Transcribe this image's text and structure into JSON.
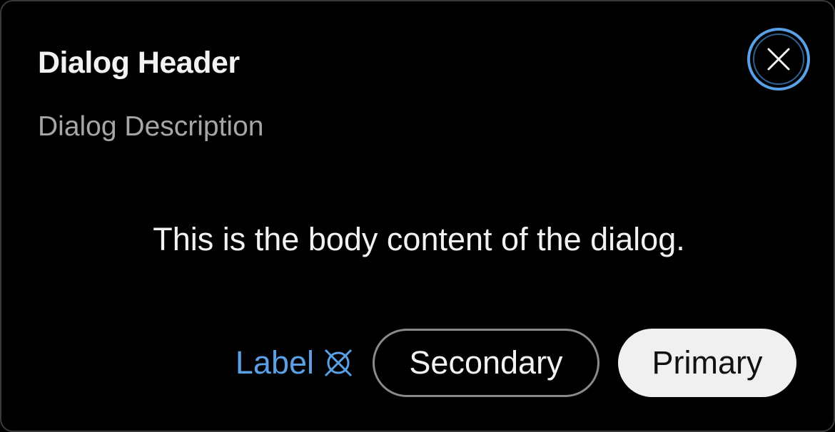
{
  "dialog": {
    "header": "Dialog Header",
    "description": "Dialog Description",
    "body": "This is the body content of the dialog.",
    "close_icon": "close-icon",
    "footer": {
      "label_link": "Label",
      "label_icon": "x-cross-icon",
      "secondary_button": "Secondary",
      "primary_button": "Primary"
    }
  },
  "colors": {
    "background": "#000000",
    "accent": "#5aa0e6",
    "primary_button_bg": "#f0f0f0",
    "text": "#f2f2f2",
    "muted_text": "#a6a6a6"
  }
}
